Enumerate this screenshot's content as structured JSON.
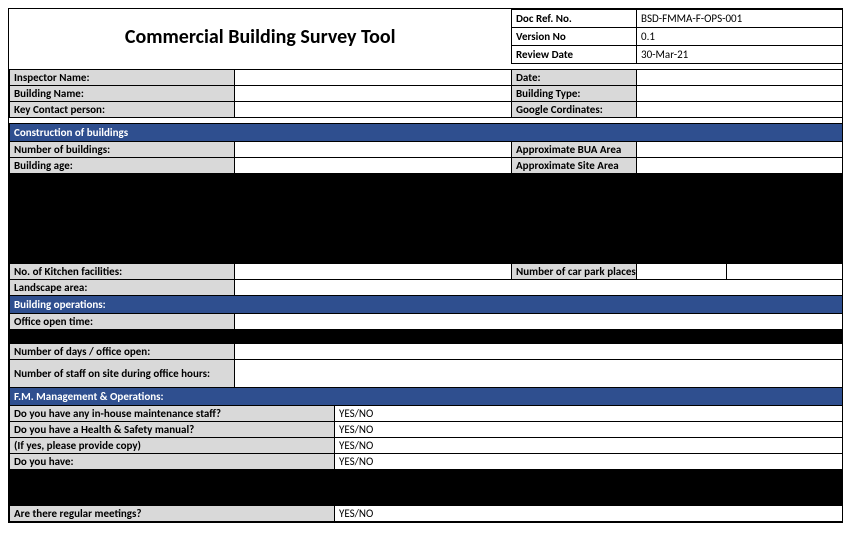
{
  "title": "Commercial Building Survey Tool",
  "docbox": {
    "ref_label": "Doc Ref. No.",
    "ref_value": "BSD-FMMA-F-OPS-001",
    "ver_label": "Version No",
    "ver_value": "0.1",
    "rev_label": "Review Date",
    "rev_value": "30-Mar-21"
  },
  "header": {
    "inspector_label": "Inspector Name:",
    "inspector_value": "",
    "date_label": "Date:",
    "date_value": "",
    "building_name_label": "Building Name:",
    "building_name_value": "",
    "building_type_label": "Building Type:",
    "building_type_value": "",
    "key_contact_label": "Key Contact person:",
    "key_contact_value": "",
    "coords_label": "Google Cordinates:",
    "coords_value": ""
  },
  "sections": {
    "construction": "Construction of buildings",
    "operations": "Building operations:",
    "fm": " F.M. Management & Operations:"
  },
  "construction": {
    "num_buildings_label": "Number of buildings:",
    "num_buildings_value": "",
    "bua_label": "Approximate BUA Area",
    "bua_value": "",
    "age_label": "Building age:",
    "age_value": "",
    "site_area_label": "Approximate Site Area",
    "site_area_value": "",
    "kitchen_label": "No. of Kitchen facilities:",
    "kitchen_value": "",
    "carpark_label": "Number of car park places:",
    "carpark_value": "",
    "landscape_label": "Landscape area:",
    "landscape_value": ""
  },
  "operations": {
    "open_time_label": "Office open time:",
    "open_time_value": "",
    "days_open_label": "Number of days / office open:",
    "days_open_value": "",
    "staff_label": "Number of staff on site during office hours:",
    "staff_value": ""
  },
  "fm": {
    "q1": "Do you have any in-house maintenance staff?",
    "q2": "Do you have a Health & Safety manual?",
    "q3": "(If yes, please provide copy)",
    "q4": "Do you have:",
    "q5": "Are there regular meetings?",
    "a1": "YES/NO",
    "a2": "YES/NO",
    "a3": "YES/NO",
    "a4": "YES/NO",
    "a5": "YES/NO"
  }
}
